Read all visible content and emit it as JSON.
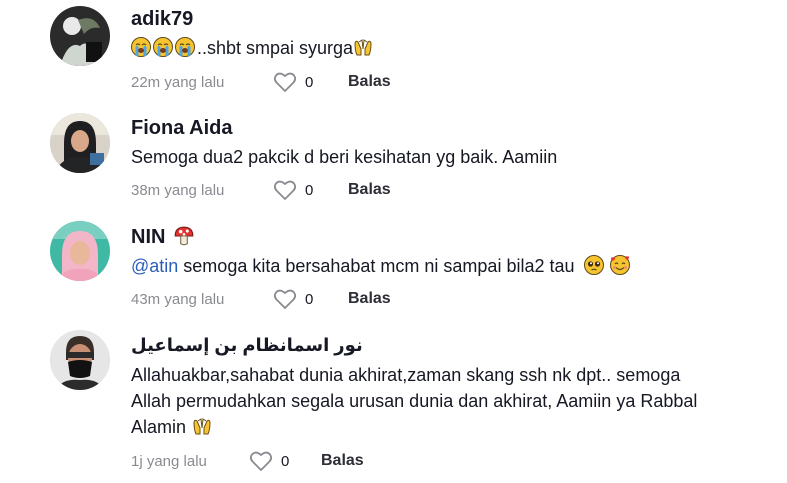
{
  "comments": [
    {
      "username": "adik79",
      "text": "..shbt smpai syurga",
      "time": "22m yang lalu",
      "likes": "0",
      "reply_label": "Balas",
      "emojis_before": [
        "loudly-crying-face",
        "loudly-crying-face",
        "loudly-crying-face"
      ],
      "emojis_after": [
        "palms-up-together"
      ]
    },
    {
      "username": "Fiona Aida",
      "text": "Semoga dua2 pakcik d beri kesihatan yg baik. Aamiin",
      "time": "38m yang lalu",
      "likes": "0",
      "reply_label": "Balas"
    },
    {
      "username": "NIN",
      "username_emoji": "mushroom",
      "mention": "@atin",
      "text": " semoga kita bersahabat mcm ni sampai bila2 tau",
      "emojis_after": [
        "pleading-face",
        "smiling-face-with-hearts"
      ],
      "time": "43m yang lalu",
      "likes": "0",
      "reply_label": "Balas"
    },
    {
      "username": "نور اسمانظام بن إسماعيل",
      "text_lines": [
        "Allahuakbar,sahabat dunia akhirat,zaman skang ssh nk dpt.. semoga",
        "Allah permudahkan segala urusan dunia dan akhirat, Aamiin ya Rabbal",
        "Alamin"
      ],
      "emojis_after": [
        "palms-up-together"
      ],
      "time": "1j yang lalu",
      "likes": "0",
      "reply_label": "Balas"
    }
  ]
}
